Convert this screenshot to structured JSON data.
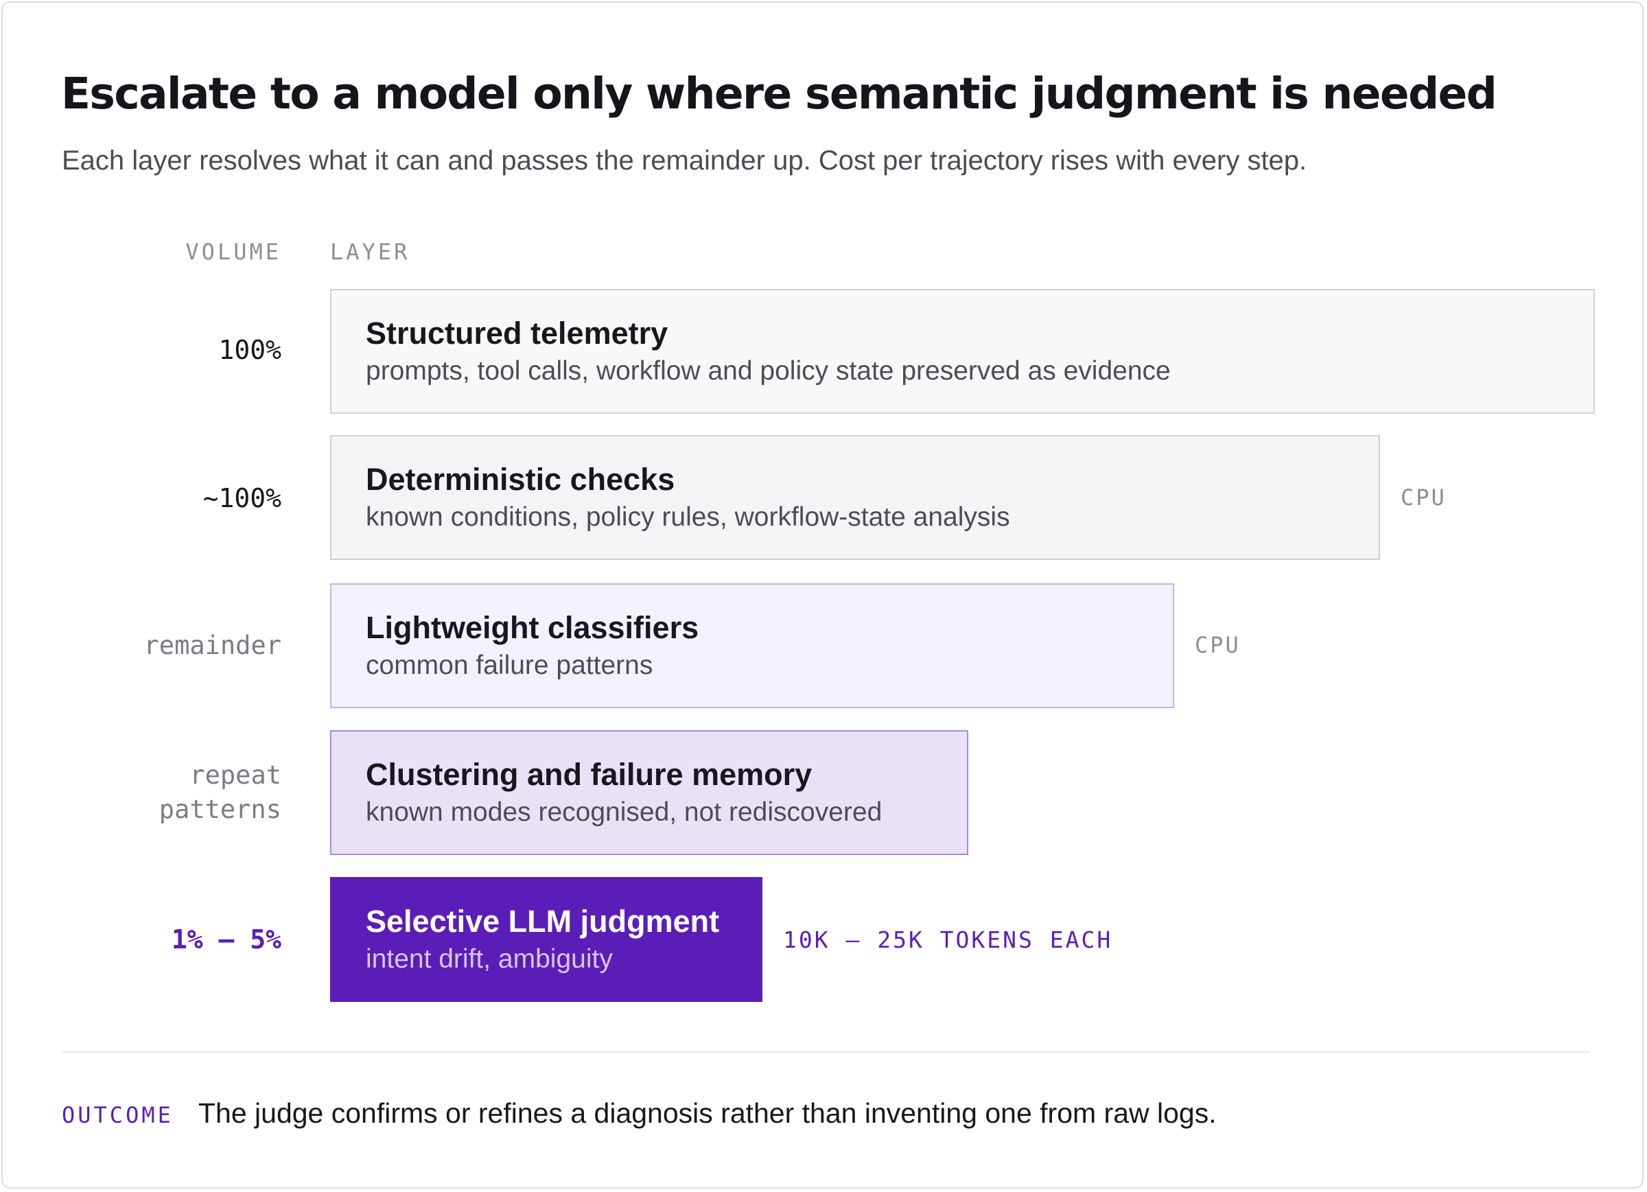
{
  "header": {
    "title": "Escalate to a model only where semantic judgment is needed",
    "subtitle": "Each layer resolves what it can and passes the remainder up. Cost per trajectory rises with every step."
  },
  "columns": {
    "volume": "VOLUME",
    "layer": "LAYER"
  },
  "layers": [
    {
      "volume": "100%",
      "name": "Structured telemetry",
      "description": "prompts, tool calls, workflow and policy state preserved as evidence",
      "tag": ""
    },
    {
      "volume": "~100%",
      "name": "Deterministic checks",
      "description": "known conditions, policy rules, workflow-state analysis",
      "tag": "CPU"
    },
    {
      "volume": "remainder",
      "name": "Lightweight classifiers",
      "description": "common failure patterns",
      "tag": "CPU"
    },
    {
      "volume": "repeat\npatterns",
      "name": "Clustering and failure memory",
      "description": "known modes recognised, not rediscovered",
      "tag": ""
    },
    {
      "volume": "1% – 5%",
      "name": "Selective LLM judgment",
      "description": "intent drift, ambiguity",
      "tag": "10K – 25K TOKENS EACH"
    }
  ],
  "outcome": {
    "label": "OUTCOME",
    "text": "The judge confirms or refines a diagnosis rather than inventing one from raw logs."
  },
  "colors": {
    "accent": "#5b1db8",
    "text": "#18171d",
    "muted": "#8d8c96",
    "classifier_fill": "#f4f1fb",
    "memory_fill": "#ebe1f7"
  }
}
